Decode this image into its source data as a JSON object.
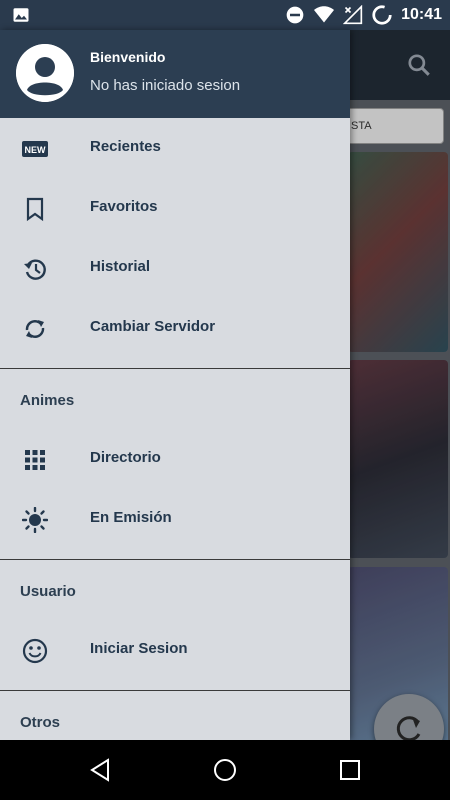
{
  "status_bar": {
    "time": "10:41",
    "icons": [
      "image-icon",
      "do-not-disturb-icon",
      "wifi-icon",
      "no-signal-icon",
      "battery-loading-icon"
    ]
  },
  "background_app": {
    "chip_text": "STA",
    "search_icon": "search-icon",
    "fab_icon": "refresh-icon"
  },
  "drawer": {
    "header": {
      "title": "Bienvenido",
      "subtitle": "No has iniciado sesion",
      "avatar_icon": "account-circle-icon"
    },
    "items": [
      {
        "label": "Recientes",
        "icon": "new-icon"
      },
      {
        "label": "Favoritos",
        "icon": "bookmark-icon"
      },
      {
        "label": "Historial",
        "icon": "history-icon"
      },
      {
        "label": "Cambiar Servidor",
        "icon": "sync-icon"
      }
    ],
    "sections": [
      {
        "title": "Animes",
        "items": [
          {
            "label": "Directorio",
            "icon": "grid-icon"
          },
          {
            "label": "En Emisión",
            "icon": "brightness-icon"
          }
        ]
      },
      {
        "title": "Usuario",
        "items": [
          {
            "label": "Iniciar Sesion",
            "icon": "smiley-icon"
          }
        ]
      },
      {
        "title": "Otros",
        "items": []
      }
    ]
  },
  "nav_bar": {
    "buttons": [
      "back-icon",
      "home-icon",
      "recents-icon"
    ]
  },
  "colors": {
    "header_bg": "#2c3e52",
    "drawer_bg": "#d8dbe0",
    "label_text": "#24384d"
  }
}
